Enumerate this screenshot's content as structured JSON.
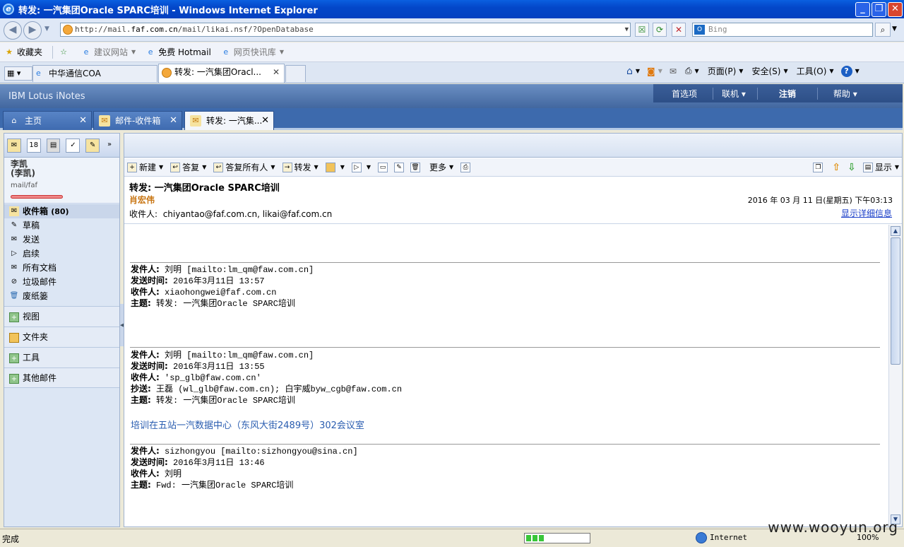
{
  "window": {
    "title": "转发: 一汽集团Oracle SPARC培训 - Windows Internet Explorer"
  },
  "browser": {
    "url_prefix": "http://mail.",
    "url_domain": "faf.com.cn",
    "url_suffix": "/mail/likai.nsf/?OpenDatabase",
    "search_placeholder": "Bing",
    "favorites": [
      "收藏夹",
      "建议网站",
      "免费 Hotmail",
      "网页快讯库"
    ],
    "tabs": [
      "中华通信COA",
      "转发: 一汽集团Oracl..."
    ],
    "commands": [
      "页面(P)",
      "安全(S)",
      "工具(O)"
    ]
  },
  "notes": {
    "brand": "IBM Lotus iNotes",
    "topmenu": [
      "首选项",
      "联机",
      "注销",
      "帮助"
    ],
    "apptabs": [
      "主页",
      "邮件-收件箱",
      "转发: 一汽集..."
    ]
  },
  "user": {
    "name": "李凯",
    "alt": "(李凯)",
    "path": "mail/faf"
  },
  "nav": [
    {
      "label": "收件箱",
      "count": "(80)"
    },
    {
      "label": "草稿"
    },
    {
      "label": "发送"
    },
    {
      "label": "启续"
    },
    {
      "label": "所有文档"
    },
    {
      "label": "垃圾邮件"
    },
    {
      "label": "废纸篓"
    }
  ],
  "sections": [
    "视图",
    "文件夹",
    "工具",
    "其他邮件"
  ],
  "toolbar": [
    "新建",
    "答复",
    "答复所有人",
    "转发",
    "更多"
  ],
  "toolbar_right": "显示",
  "message": {
    "subject": "转发: 一汽集团Oracle SPARC培训",
    "sender": "肖宏伟",
    "date": "2016 年 03 月 11 日(星期五) 下午03:13",
    "recipients_label": "收件人:",
    "recipients": "chiyantao@faf.com.cn, likai@faf.com.cn",
    "details_link": "显示详细信息"
  },
  "forwards": [
    {
      "from_label": "发件人:",
      "from": "刘明 [mailto:lm_qm@faw.com.cn]",
      "sent_label": "发送时间:",
      "sent": "2016年3月11日 13:57",
      "to_label": "收件人:",
      "to": "xiaohongwei@faf.com.cn",
      "subj_label": "主题:",
      "subj": "转发: 一汽集团Oracle SPARC培训"
    },
    {
      "from_label": "发件人:",
      "from": "刘明 [mailto:lm_qm@faw.com.cn]",
      "sent_label": "发送时间:",
      "sent": "2016年3月11日 13:55",
      "to_label": "收件人:",
      "to": "'sp_glb@faw.com.cn'",
      "cc_label": "抄送:",
      "cc": "王磊 (wl_glb@faw.com.cn); 白宇威byw_cgb@faw.com.cn",
      "subj_label": "主题:",
      "subj": "转发: 一汽集团Oracle SPARC培训"
    },
    {
      "from_label": "发件人:",
      "from": "sizhongyou [mailto:sizhongyou@sina.cn]",
      "sent_label": "发送时间:",
      "sent": "2016年3月11日 13:46",
      "to_label": "收件人:",
      "to": "刘明",
      "subj_label": "主题:",
      "subj": "Fwd: 一汽集团Oracle SPARC培训"
    }
  ],
  "venue": "培训在五站一汽数据中心（东风大街2489号）302会议室",
  "status": {
    "left": "完成",
    "zone": "Internet",
    "zoom": "100%",
    "progress": 0.3
  },
  "watermark": "www.wooyun.org"
}
